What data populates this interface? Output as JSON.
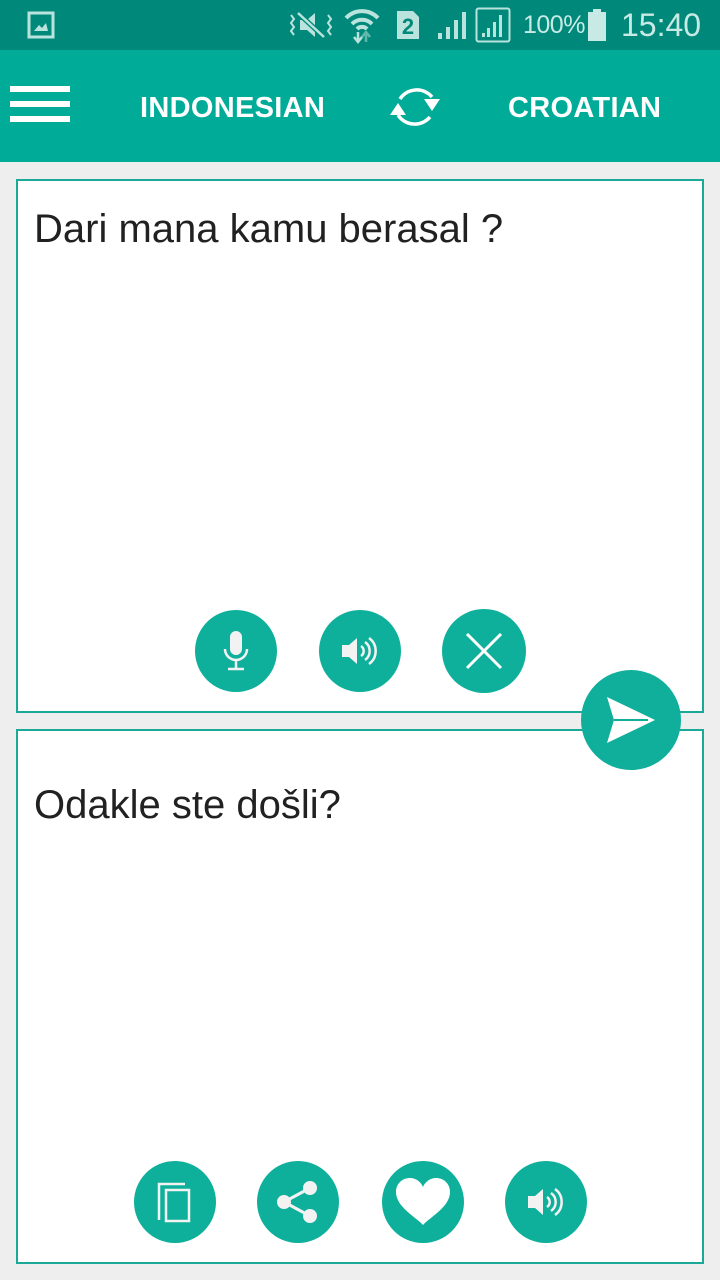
{
  "status_bar": {
    "icons": [
      "gallery-icon",
      "vibrate-mute-icon",
      "wifi-icon",
      "sim-2-icon",
      "signal-icon",
      "signal-icon-sim2"
    ],
    "sim_label": "2",
    "battery": "100%",
    "time": "15:40"
  },
  "app_bar": {
    "menu_icon": "hamburger-menu-icon",
    "source_language": "INDONESIAN",
    "swap_icon": "swap-languages-icon",
    "target_language": "CROATIAN"
  },
  "source_panel": {
    "text": "Dari mana kamu berasal ?",
    "buttons": [
      {
        "name": "microphone",
        "icon": "microphone-icon"
      },
      {
        "name": "speak",
        "icon": "speaker-icon"
      },
      {
        "name": "clear",
        "icon": "close-icon"
      }
    ]
  },
  "translate_button": {
    "icon": "send-icon"
  },
  "target_panel": {
    "text": "Odakle ste došli?",
    "buttons": [
      {
        "name": "copy",
        "icon": "copy-icon"
      },
      {
        "name": "share",
        "icon": "share-icon"
      },
      {
        "name": "favorite",
        "icon": "heart-icon"
      },
      {
        "name": "speak",
        "icon": "speaker-icon"
      }
    ]
  },
  "colors": {
    "status_bar": "#00897b",
    "app_bar": "#00ac98",
    "accent": "#0fb09b",
    "panel_border": "#1aa899",
    "background": "#eeeeee",
    "text": "#212121"
  }
}
